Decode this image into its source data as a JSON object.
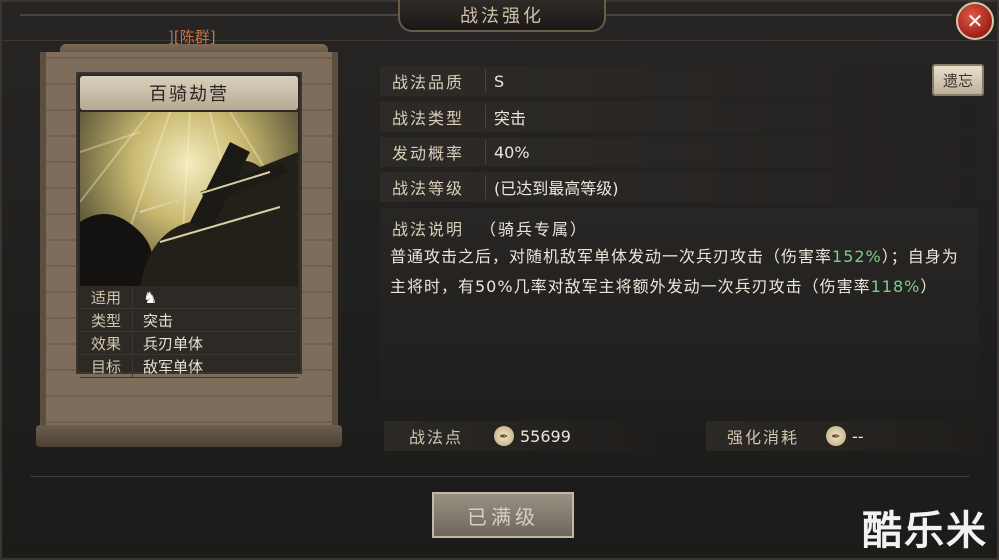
{
  "window": {
    "title": "战法强化",
    "close": "✕"
  },
  "scroll": {
    "name_prefix": "]",
    "general_name": "[陈群]"
  },
  "card": {
    "title": "百骑劫营",
    "props": [
      {
        "key": "适用",
        "value": ""
      },
      {
        "key": "类型",
        "value": "突击"
      },
      {
        "key": "效果",
        "value": "兵刃单体"
      },
      {
        "key": "目标",
        "value": "敌军单体"
      }
    ]
  },
  "info": {
    "quality_label": "战法品质",
    "quality_value": "S",
    "type_label": "战法类型",
    "type_value": "突击",
    "rate_label": "发动概率",
    "rate_value": "40%",
    "level_label": "战法等级",
    "level_value": "(已达到最高等级)",
    "forget_button": "遗忘"
  },
  "description": {
    "label": "战法说明",
    "subtitle": "（骑兵专属）",
    "part1": "普通攻击之后，对随机敌军单体发动一次兵刃攻击（伤害率",
    "rate1": "152%",
    "part2": "）；自身为主将时，有50%几率对敌军主将额外发动一次兵刃攻击（伤害率",
    "rate2": "118%",
    "part3": "）"
  },
  "bottom": {
    "points_label": "战法点",
    "points_value": "55699",
    "cost_label": "强化消耗",
    "cost_value": "--"
  },
  "action": {
    "max_button": "已满级"
  },
  "watermark": "酷乐米",
  "icons": {
    "close": "close-icon",
    "horse": "horse-icon",
    "coin": "coin-icon"
  },
  "colors": {
    "accent_green": "#7dcd8a",
    "name_orange": "#c8733e",
    "close_red": "#b3271c"
  }
}
